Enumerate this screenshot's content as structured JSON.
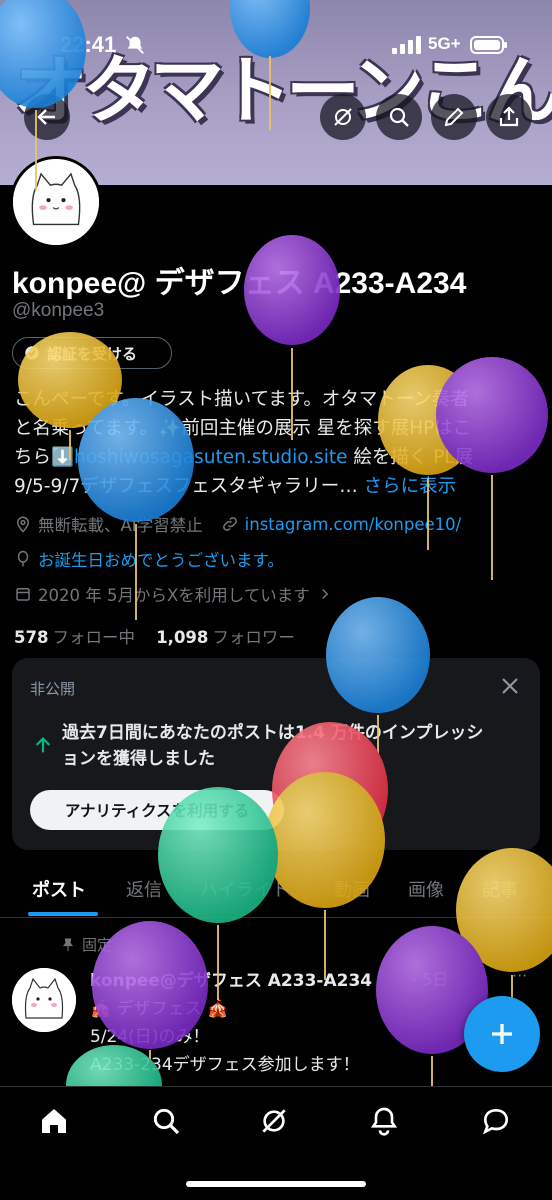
{
  "status_bar": {
    "time": "22:41",
    "network": "5G+"
  },
  "banner": {
    "art_text": "オタマトーンこんぺー"
  },
  "profile": {
    "display_name": "konpee@ デザフェス A233-A234",
    "handle": "@konpee3",
    "verify_label": "認証を受ける",
    "bio_line1": "こんぺーです。イラスト描いてます。オタマトーン奏者",
    "bio_line2": "と名乗ってます。✨前回主催の展示 星を探す展HPはこ",
    "bio_line3_prefix": "ちら⬇️",
    "bio_link": "hoshiwosagasuten.studio.site",
    "bio_line3_suffix": " 絵を描く PL展",
    "bio_line4": "9/5-9/7デザフェスフェスタギャラリー… ",
    "bio_more": "さらに表示",
    "location": "無断転載、AI学習禁止",
    "website": "instagram.com/konpee10/",
    "birthday": "お誕生日おめでとうございます。",
    "joined": "2020 年 5月からXを利用しています",
    "following_count": "578",
    "following_label": "フォロー中",
    "followers_count": "1,098",
    "followers_label": "フォロワー"
  },
  "private_card": {
    "label": "非公開",
    "impressions_line1": "過去7日間にあなたのポストは1.4 万件のインプレッシ",
    "impressions_line2": "ョンを獲得しました",
    "analytics_button": "アナリティクスを利用する"
  },
  "tabs": [
    "ポスト",
    "返信",
    "ハイライト",
    "動画",
    "画像",
    "記事"
  ],
  "post": {
    "pinned_label": "固定",
    "author": "konpee@デザフェス A233-A234",
    "meta": "· 5日",
    "more": "···",
    "line1": "🎪 デザフェス 🎪",
    "line2": "5/24(日)のみ！",
    "line3": "A233-234デザフェス参加します！"
  },
  "colors": {
    "accent": "#1d9bf0",
    "background": "#000000",
    "card": "#16181c",
    "muted": "#71767b"
  },
  "icons": [
    "back-arrow-icon",
    "grok-icon",
    "search-icon",
    "pencil-icon",
    "share-icon",
    "home-icon",
    "explore-icon",
    "grok-nav-icon",
    "bell-icon",
    "messages-icon",
    "plus-icon"
  ]
}
